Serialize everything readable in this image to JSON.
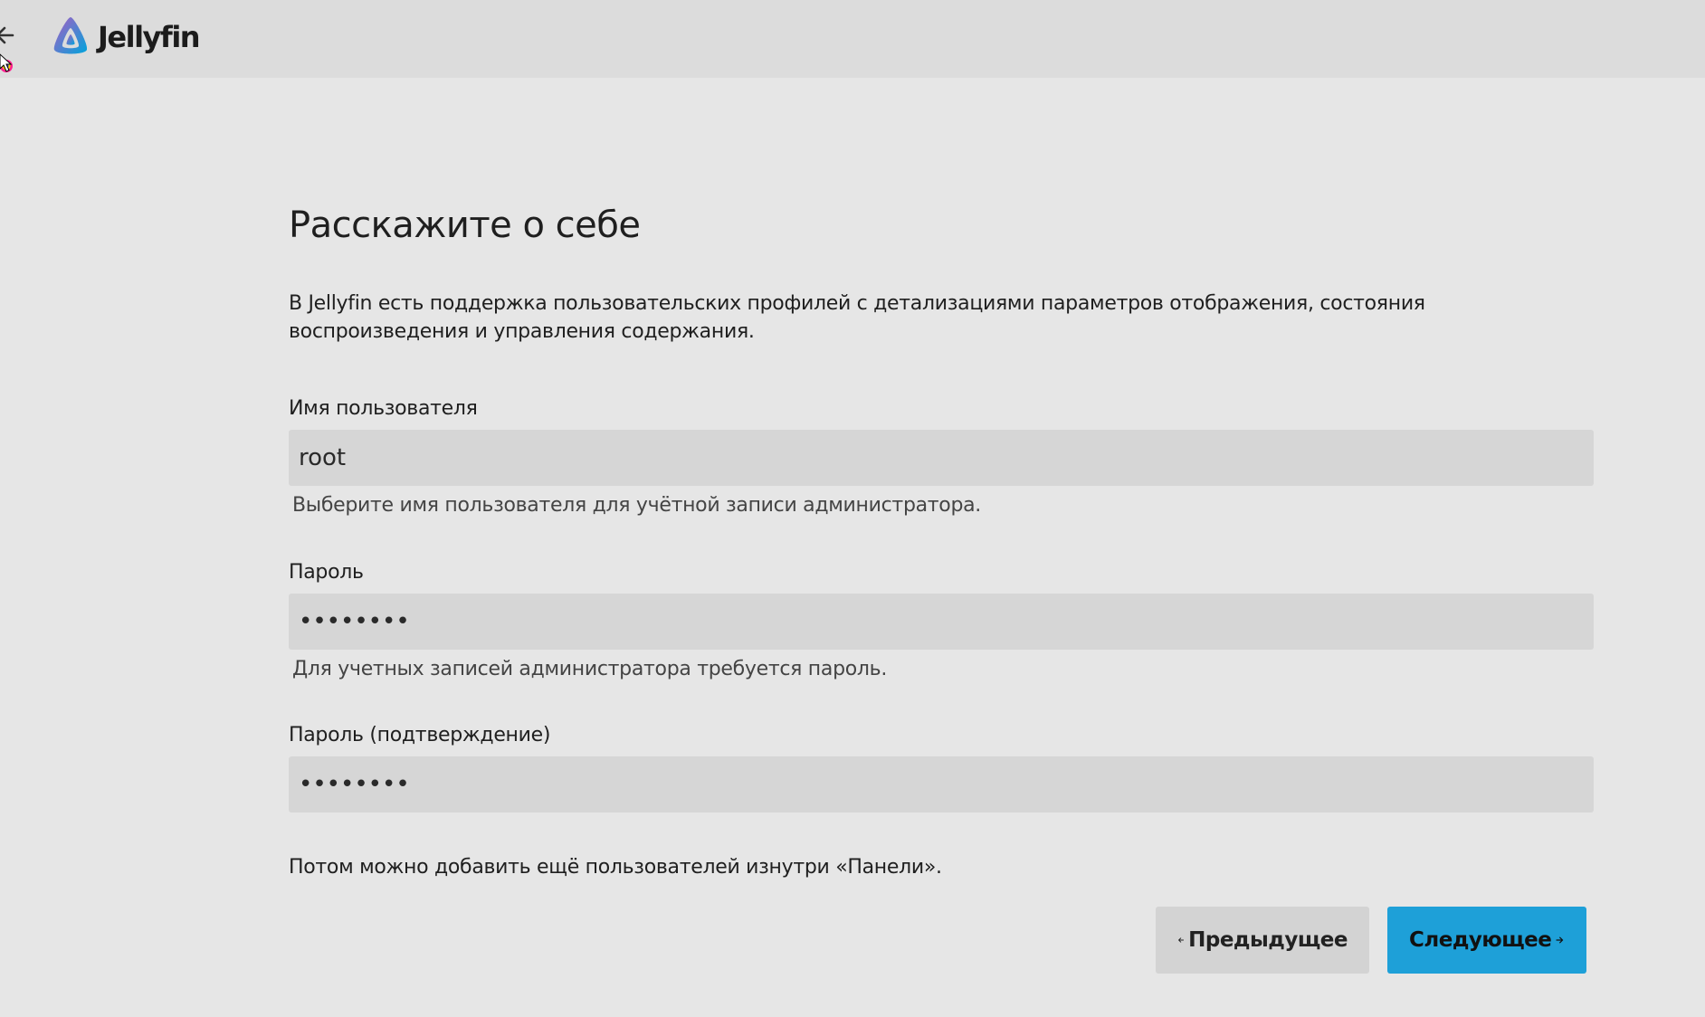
{
  "header": {
    "brand": "Jellyfin",
    "back_icon": "arrow-left-icon",
    "logo_icon": "jellyfin-logo-icon"
  },
  "main": {
    "title": "Расскажите о себе",
    "intro": "В Jellyfin есть поддержка пользовательских профилей с детализациями параметров отображения, состояния воспроизведения и управления содержания.",
    "fields": {
      "username": {
        "label": "Имя пользователя",
        "value": "root",
        "hint": "Выберите имя пользователя для учётной записи администратора."
      },
      "password": {
        "label": "Пароль",
        "value": "••••••••",
        "hint": "Для учетных записей администратора требуется пароль."
      },
      "password_confirm": {
        "label": "Пароль (подтверждение)",
        "value": "••••••••"
      }
    },
    "footer_note": "Потом можно добавить ещё пользователей изнутри «Панели»."
  },
  "buttons": {
    "previous": "Предыдущее",
    "next": "Следующее"
  },
  "colors": {
    "accent": "#1ea0d8",
    "background": "#e6e6e6",
    "header": "#dcdcdc",
    "input": "#d6d6d6"
  }
}
